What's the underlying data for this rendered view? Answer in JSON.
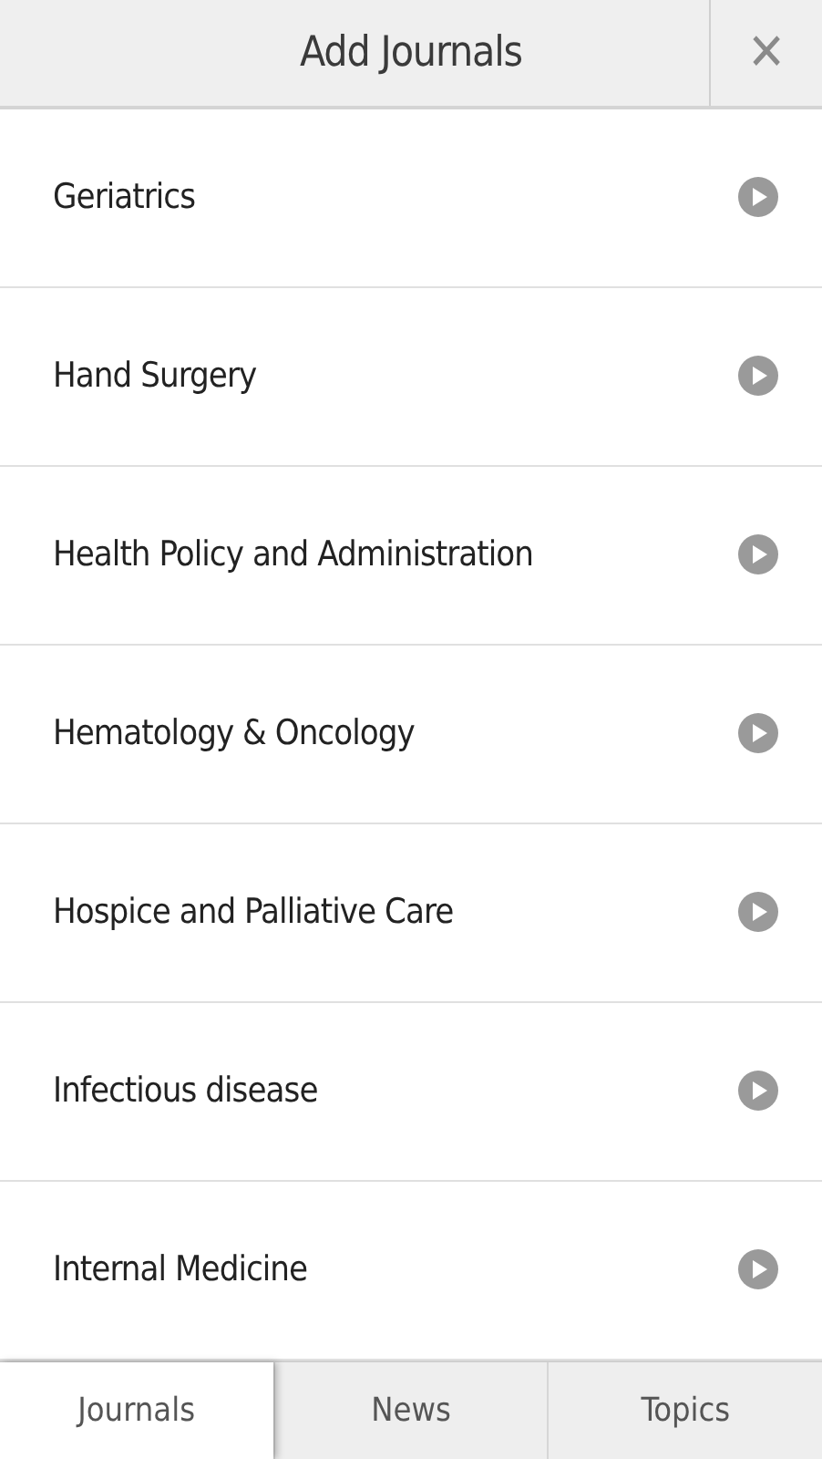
{
  "header": {
    "title": "Add Journals",
    "close": "✕"
  },
  "journals": [
    {
      "name": "Geriatrics"
    },
    {
      "name": "Hand Surgery"
    },
    {
      "name": "Health Policy and Administration"
    },
    {
      "name": "Hematology & Oncology"
    },
    {
      "name": "Hospice and Palliative Care"
    },
    {
      "name": "Infectious disease"
    },
    {
      "name": "Internal Medicine"
    }
  ],
  "tabs": [
    {
      "label": "Journals",
      "selected": true
    },
    {
      "label": "News",
      "selected": false
    },
    {
      "label": "Topics",
      "selected": false
    }
  ]
}
